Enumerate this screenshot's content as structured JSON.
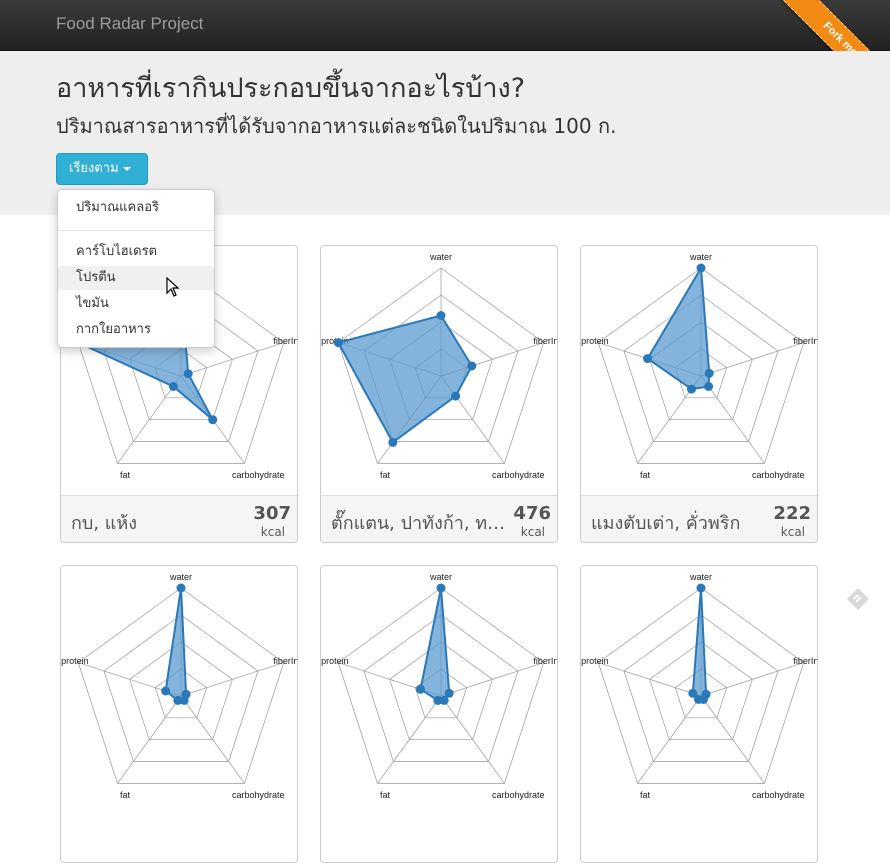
{
  "navbar": {
    "brand": "Food Radar Project"
  },
  "ribbon": {
    "label": "Fork me on GitHub",
    "color": "#f28a14"
  },
  "header": {
    "title": "อาหารที่เรากินประกอบขึ้นจากอะไรบ้าง?",
    "subtitle": "ปริมาณสารอาหารที่ได้รับจากอาหารแต่ละชนิดในปริมาณ 100 ก."
  },
  "sort": {
    "button_label": "เรียงตาม",
    "menu": [
      {
        "label": "ปริมาณแคลอริ"
      },
      {
        "label": "คาร์โบไฮเดรต"
      },
      {
        "label": "โปรตีน",
        "highlighted": true
      },
      {
        "label": "ไขมัน"
      },
      {
        "label": "กากใยอาหาร"
      }
    ]
  },
  "radar": {
    "axes": [
      "water",
      "fiberInsoluble",
      "carbohydrate",
      "fat",
      "protein"
    ],
    "fill_color": "#5b9bd0",
    "stroke_color": "#2b78b8"
  },
  "cards": [
    {
      "name": "กบ, แห้ง",
      "kcal": "307",
      "unit": "kcal",
      "values": [
        0.8,
        0.07,
        0.5,
        0.12,
        1.0
      ]
    },
    {
      "name": "ตั๊กแตน, ปาทังก้า, ทอด",
      "kcal": "476",
      "unit": "kcal",
      "values": [
        0.56,
        0.3,
        0.23,
        0.76,
        1.0
      ]
    },
    {
      "name": "แมงตับเต่า, คั่วพริก",
      "kcal": "222",
      "unit": "kcal",
      "values": [
        1.0,
        0.08,
        0.12,
        0.15,
        0.52
      ]
    },
    {
      "name": "",
      "kcal": "",
      "unit": "",
      "values": [
        1.0,
        0.05,
        0.05,
        0.05,
        0.15
      ]
    },
    {
      "name": "",
      "kcal": "",
      "unit": "",
      "values": [
        1.0,
        0.08,
        0.05,
        0.05,
        0.2
      ]
    },
    {
      "name": "",
      "kcal": "",
      "unit": "",
      "values": [
        1.0,
        0.05,
        0.04,
        0.04,
        0.08
      ]
    }
  ]
}
